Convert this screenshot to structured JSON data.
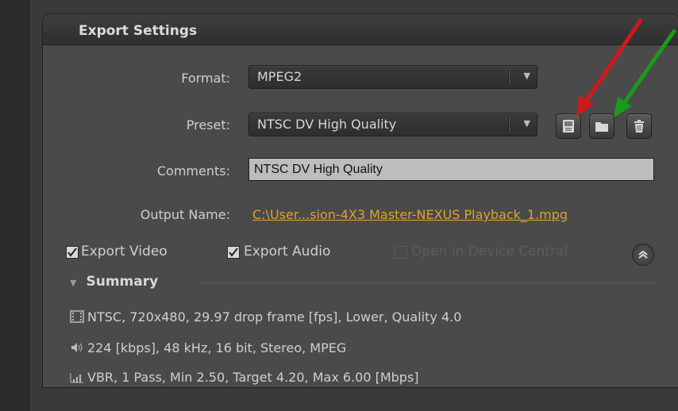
{
  "panel": {
    "title": "Export Settings"
  },
  "format": {
    "label": "Format:",
    "value": "MPEG2"
  },
  "preset": {
    "label": "Preset:",
    "value": "NTSC DV High Quality"
  },
  "comments": {
    "label": "Comments:",
    "value": "NTSC DV High Quality"
  },
  "output": {
    "label": "Output Name:",
    "value": "C:\\User...sion-4X3 Master-NEXUS Playback_1.mpg"
  },
  "checkboxes": {
    "export_video": {
      "label": "Export Video",
      "checked": true
    },
    "export_audio": {
      "label": "Export Audio",
      "checked": true
    },
    "device_central": {
      "label": "Open in Device Central",
      "checked": false,
      "disabled": true
    }
  },
  "summary": {
    "title": "Summary",
    "video": "NTSC, 720x480, 29.97 drop frame [fps], Lower, Quality 4.0",
    "audio": "224 [kbps], 48 kHz, 16 bit, Stereo, MPEG",
    "bitrate": "VBR, 1 Pass, Min 2.50, Target 4.20, Max 6.00 [Mbps]"
  },
  "icons": {
    "save_preset": "save-icon",
    "import_preset": "folder-icon",
    "delete_preset": "trash-icon",
    "collapse": "chevron-up-icon",
    "video": "film-icon",
    "audio": "speaker-icon",
    "bitrate": "bar-chart-icon"
  },
  "colors": {
    "link": "#e0a22a",
    "red_arrow": "#d01818",
    "green_arrow": "#1a9a1a"
  }
}
